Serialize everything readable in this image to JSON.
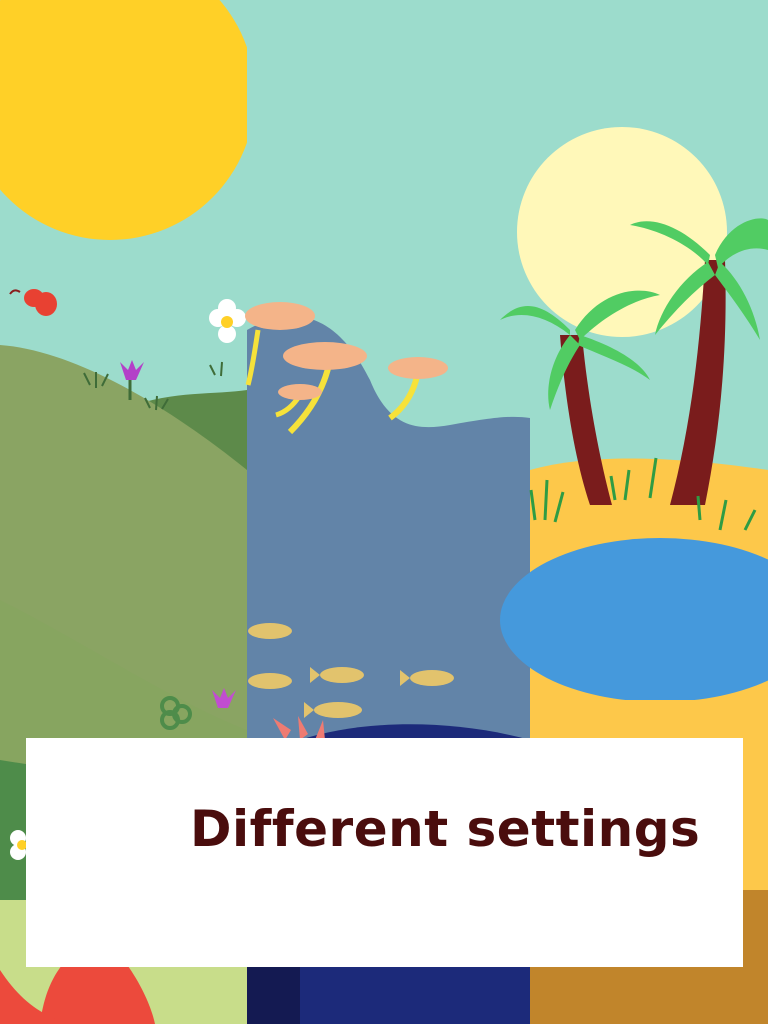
{
  "caption": {
    "text": "Different settings"
  },
  "scenes": [
    {
      "name": "meadow",
      "colors": {
        "sky": "#9cdccc",
        "sun": "#ffd027",
        "hill": "#8aa463",
        "hill_dark": "#5d8a4a"
      }
    },
    {
      "name": "underwater",
      "colors": {
        "water": "#6284a8",
        "deep": "#1c2a7a",
        "mushroom": "#f4b489",
        "stem": "#f6e23a",
        "fish": "#e2c36d"
      }
    },
    {
      "name": "oasis",
      "colors": {
        "sun": "#fff8b9",
        "sand": "#fdc84a",
        "pool": "#4599dc",
        "trunk": "#7a1c1c",
        "leaves": "#51cc63"
      }
    }
  ],
  "mascot": {
    "name": "red dinosaur",
    "color": "#ec4a3c"
  }
}
